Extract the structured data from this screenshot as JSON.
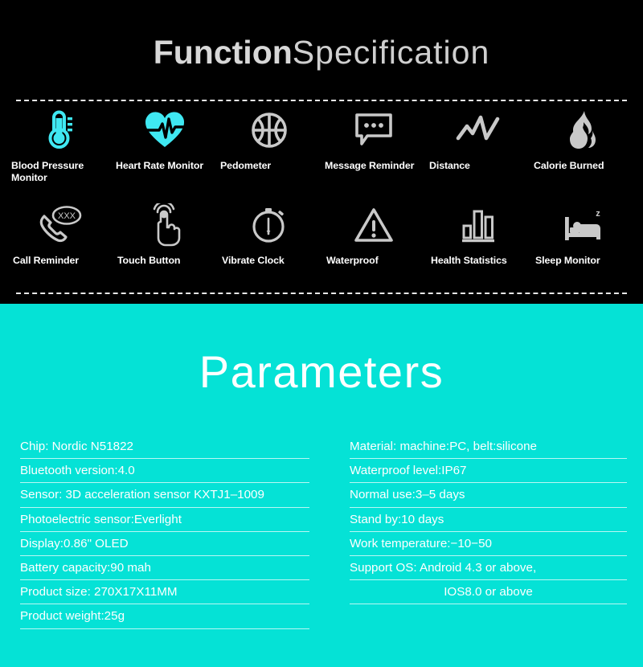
{
  "function_section": {
    "title_bold": "Function",
    "title_thin": "Specification",
    "features": [
      {
        "icon": "thermometer-icon",
        "label": "Blood Pressure Monitor",
        "color": "#3FE8F2"
      },
      {
        "icon": "heart-pulse-icon",
        "label": "Heart Rate Monitor",
        "color": "#3FE8F2"
      },
      {
        "icon": "basketball-icon",
        "label": "Pedometer",
        "color": "#C9C9C9"
      },
      {
        "icon": "speech-bubble-icon",
        "label": "Message Reminder",
        "color": "#C9C9C9"
      },
      {
        "icon": "zigzag-line-icon",
        "label": "Distance",
        "color": "#C9C9C9"
      },
      {
        "icon": "flame-icon",
        "label": "Calorie Burned",
        "color": "#C9C9C9"
      },
      {
        "icon": "phone-handset-icon",
        "label": "Call Reminder",
        "color": "#C9C9C9"
      },
      {
        "icon": "touch-hand-icon",
        "label": "Touch Button",
        "color": "#C9C9C9"
      },
      {
        "icon": "stopwatch-icon",
        "label": "Vibrate Clock",
        "color": "#C9C9C9"
      },
      {
        "icon": "warning-triangle-icon",
        "label": "Waterproof",
        "color": "#C9C9C9"
      },
      {
        "icon": "bar-chart-icon",
        "label": "Health Statistics",
        "color": "#C9C9C9"
      },
      {
        "icon": "bed-sleep-icon",
        "label": "Sleep Monitor",
        "color": "#C9C9C9"
      }
    ],
    "call_reminder_bubble_text": "XXX",
    "sleep_icon_z_text": "z"
  },
  "parameters_section": {
    "title": "Parameters",
    "background_color": "#05E2D6",
    "left_column": [
      "Chip: Nordic N51822",
      "Bluetooth version:4.0",
      "Sensor: 3D acceleration sensor KXTJ1–1009",
      "Photoelectric sensor:Everlight",
      "Display:0.86\" OLED",
      "Battery capacity:90 mah",
      "Product size: 270X17X11MM",
      "Product weight:25g"
    ],
    "right_column": [
      "Material: machine:PC, belt:silicone",
      "Waterproof level:IP67",
      "Normal use:3–5 days",
      "Stand by:10 days",
      "Work temperature:−10−50",
      "Support OS: Android 4.3 or above,",
      "IOS8.0 or above"
    ]
  }
}
